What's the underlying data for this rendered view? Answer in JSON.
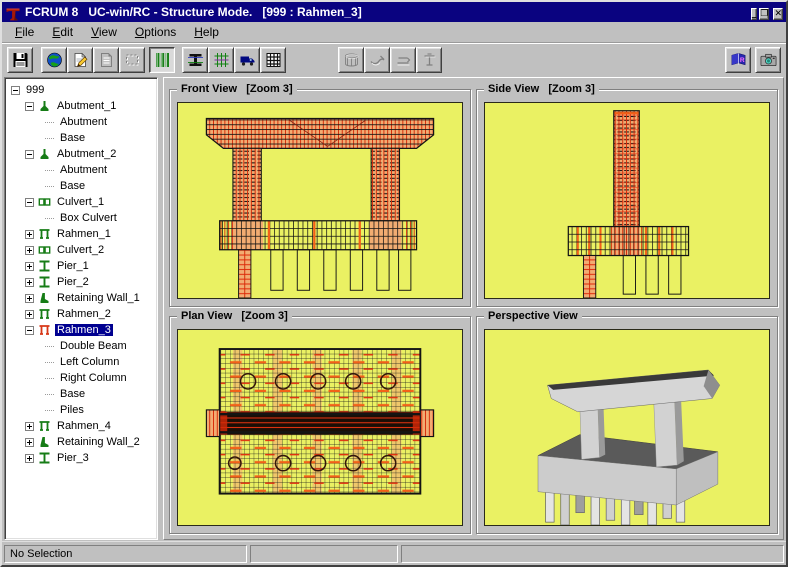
{
  "window": {
    "title": "FCRUM 8   UC-win/RC - Structure Mode.   [999 : Rahmen_3]",
    "app_icon": "pier-logo-icon",
    "controls": [
      {
        "name": "minimize-button",
        "glyph": "_"
      },
      {
        "name": "restore-button",
        "glyph": "❐"
      },
      {
        "name": "close-button",
        "glyph": "✕"
      }
    ]
  },
  "menubar": {
    "items": [
      {
        "label": "File"
      },
      {
        "label": "Edit"
      },
      {
        "label": "View"
      },
      {
        "label": "Options"
      },
      {
        "label": "Help"
      }
    ]
  },
  "toolbar": {
    "left_buttons": [
      {
        "name": "save-button",
        "icon": "save-icon",
        "state": "normal",
        "gap": 0
      },
      {
        "name": "globe-button",
        "icon": "globe-icon",
        "state": "normal",
        "gap": 8
      },
      {
        "name": "edit-document-button",
        "icon": "edit-document-icon",
        "state": "normal",
        "gap": 0
      },
      {
        "name": "document-button",
        "icon": "document-icon",
        "state": "disabled",
        "gap": 0
      },
      {
        "name": "selection-button",
        "icon": "selection-icon",
        "state": "disabled",
        "gap": 0
      },
      {
        "name": "structure-mode-button",
        "icon": "structure-columns-icon",
        "state": "pressed",
        "gap": 4
      },
      {
        "name": "section-button",
        "icon": "ibeam-section-icon",
        "state": "normal",
        "gap": 7
      },
      {
        "name": "rebar-button",
        "icon": "rebar-icon",
        "state": "normal",
        "gap": 0
      },
      {
        "name": "load-truck-button",
        "icon": "truck-icon",
        "state": "normal",
        "gap": 0
      },
      {
        "name": "table-button",
        "icon": "grid-table-icon",
        "state": "normal",
        "gap": 0
      },
      {
        "name": "cage-button",
        "icon": "cage-icon",
        "state": "disabled",
        "gap": 52
      },
      {
        "name": "stirrup-button",
        "icon": "stirrup-icon",
        "state": "disabled",
        "gap": 0
      },
      {
        "name": "bend-bar-button",
        "icon": "bend-bar-icon",
        "state": "disabled",
        "gap": 0
      },
      {
        "name": "hoop-bar-button",
        "icon": "hoop-bar-icon",
        "state": "disabled",
        "gap": 0
      }
    ],
    "right_buttons": [
      {
        "name": "reference-book-button",
        "icon": "reference-book-icon",
        "state": "normal",
        "gap": 0
      },
      {
        "name": "snapshot-button",
        "icon": "camera-icon",
        "state": "normal",
        "gap": 4
      }
    ]
  },
  "tree": {
    "items": [
      {
        "label": "999",
        "depth": 0,
        "toggle": "minus"
      },
      {
        "label": "Abutment_1",
        "depth": 1,
        "toggle": "minus",
        "icon": "abutment-icon",
        "icon_color": "green"
      },
      {
        "label": "Abutment",
        "depth": 2
      },
      {
        "label": "Base",
        "depth": 2
      },
      {
        "label": "Abutment_2",
        "depth": 1,
        "toggle": "minus",
        "icon": "abutment-icon",
        "icon_color": "green"
      },
      {
        "label": "Abutment",
        "depth": 2
      },
      {
        "label": "Base",
        "depth": 2
      },
      {
        "label": "Culvert_1",
        "depth": 1,
        "toggle": "minus",
        "icon": "culvert-icon",
        "icon_color": "green"
      },
      {
        "label": "Box Culvert",
        "depth": 2
      },
      {
        "label": "Rahmen_1",
        "depth": 1,
        "toggle": "plus",
        "icon": "rahmen-icon",
        "icon_color": "green"
      },
      {
        "label": "Culvert_2",
        "depth": 1,
        "toggle": "plus",
        "icon": "culvert-icon",
        "icon_color": "green"
      },
      {
        "label": "Pier_1",
        "depth": 1,
        "toggle": "plus",
        "icon": "pier-icon",
        "icon_color": "green"
      },
      {
        "label": "Pier_2",
        "depth": 1,
        "toggle": "plus",
        "icon": "pier-icon",
        "icon_color": "green"
      },
      {
        "label": "Retaining Wall_1",
        "depth": 1,
        "toggle": "plus",
        "icon": "retaining-wall-icon",
        "icon_color": "green"
      },
      {
        "label": "Rahmen_2",
        "depth": 1,
        "toggle": "plus",
        "icon": "rahmen-icon",
        "icon_color": "green"
      },
      {
        "label": "Rahmen_3",
        "depth": 1,
        "toggle": "minus",
        "icon": "rahmen-icon",
        "icon_color": "red",
        "selected": true
      },
      {
        "label": "Double Beam",
        "depth": 2
      },
      {
        "label": "Left Column",
        "depth": 2
      },
      {
        "label": "Right Column",
        "depth": 2
      },
      {
        "label": "Base",
        "depth": 2
      },
      {
        "label": "Piles",
        "depth": 2
      },
      {
        "label": "Rahmen_4",
        "depth": 1,
        "toggle": "plus",
        "icon": "rahmen-icon",
        "icon_color": "green"
      },
      {
        "label": "Retaining Wall_2",
        "depth": 1,
        "toggle": "plus",
        "icon": "retaining-wall-icon",
        "icon_color": "green"
      },
      {
        "label": "Pier_3",
        "depth": 1,
        "toggle": "plus",
        "icon": "pier-icon",
        "icon_color": "green"
      }
    ]
  },
  "views": {
    "front": {
      "title": "Front View   [Zoom 3]"
    },
    "side": {
      "title": "Side View   [Zoom 3]"
    },
    "plan": {
      "title": "Plan View   [Zoom 3]"
    },
    "perspective": {
      "title": "Perspective View"
    }
  },
  "statusbar": {
    "sections": [
      {
        "text": "No Selection"
      },
      {
        "text": ""
      },
      {
        "text": ""
      }
    ]
  },
  "colors": {
    "titlebar": "#0A0380",
    "chrome": "#C0C0C0",
    "canvas": "#EAF163",
    "rebar_red": "#D62A08",
    "rebar_orange": "#F26018",
    "concrete_salmon": "#F2AC72",
    "tree_green": "#167C16",
    "tree_red": "#D83818",
    "selection": "#000090"
  }
}
